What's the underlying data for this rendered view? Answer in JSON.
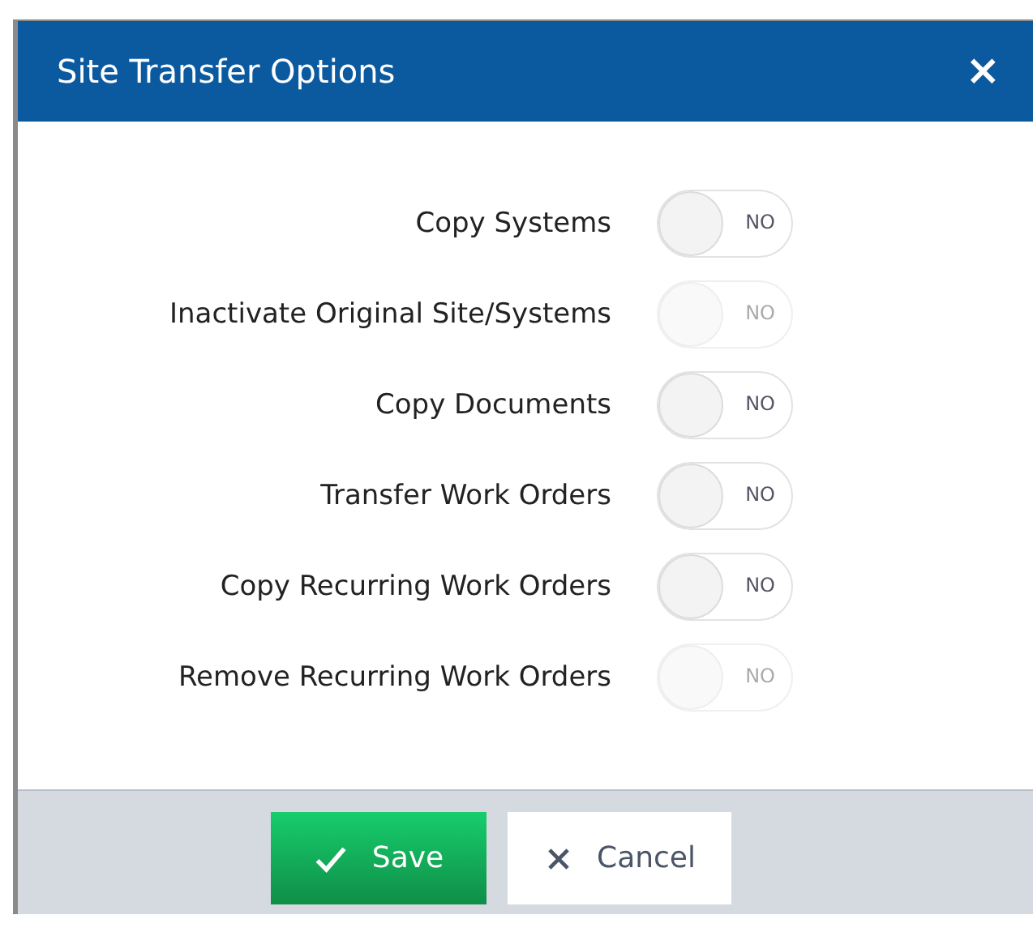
{
  "dialog": {
    "title": "Site Transfer Options",
    "close": "×"
  },
  "options": [
    {
      "label": "Copy Systems",
      "on": false,
      "disabled": false,
      "state_text": "NO"
    },
    {
      "label": "Inactivate Original Site/Systems",
      "on": false,
      "disabled": true,
      "state_text": "NO"
    },
    {
      "label": "Copy Documents",
      "on": false,
      "disabled": false,
      "state_text": "NO"
    },
    {
      "label": "Transfer Work Orders",
      "on": false,
      "disabled": false,
      "state_text": "NO"
    },
    {
      "label": "Copy Recurring Work Orders",
      "on": false,
      "disabled": false,
      "state_text": "NO"
    },
    {
      "label": "Remove Recurring Work Orders",
      "on": false,
      "disabled": true,
      "state_text": "NO"
    }
  ],
  "buttons": [
    {
      "kind": "save",
      "label": "Save"
    },
    {
      "kind": "cancel",
      "label": "Cancel"
    }
  ]
}
